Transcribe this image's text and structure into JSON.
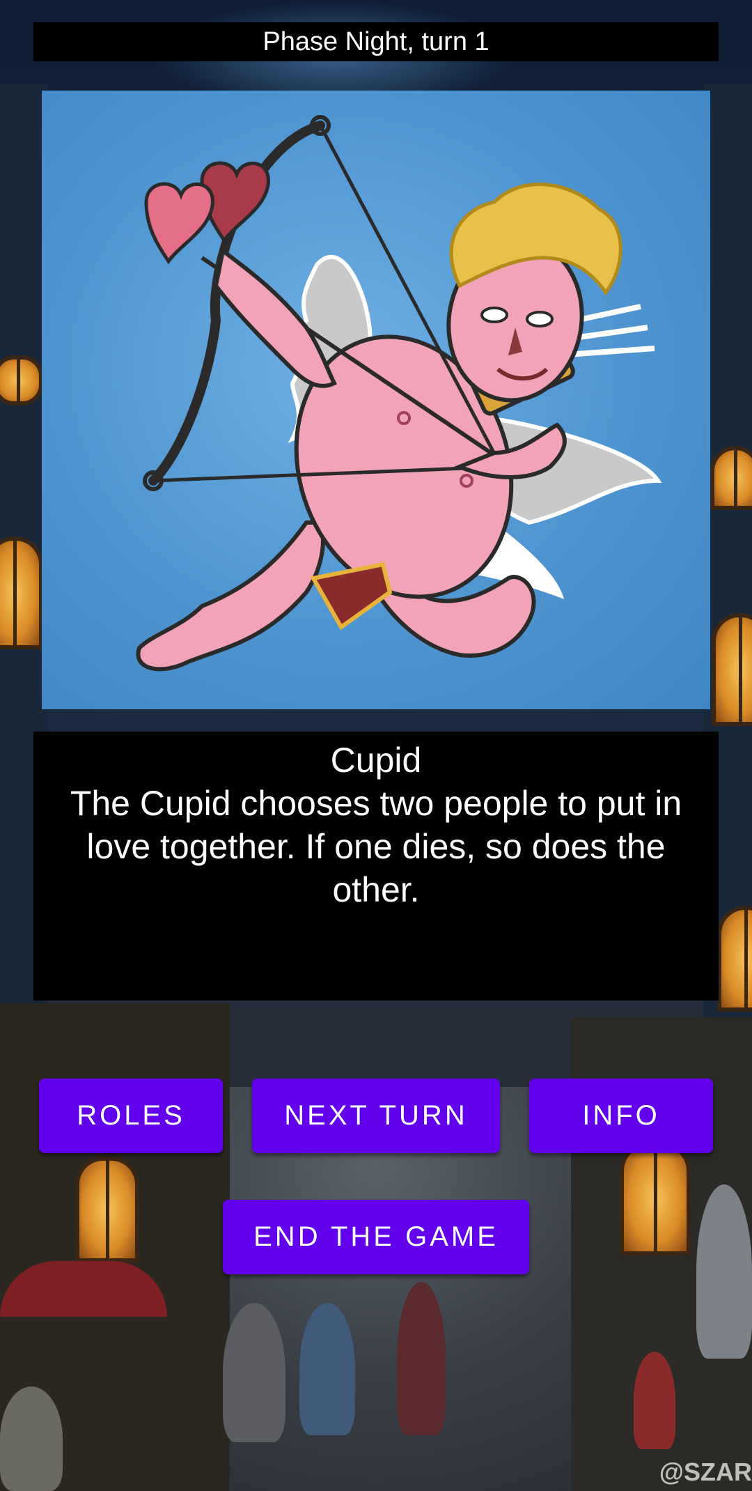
{
  "phase": {
    "label": "Phase Night, turn 1"
  },
  "card": {
    "image_subject": "cupid-illustration"
  },
  "role": {
    "name": "Cupid",
    "description": "The Cupid chooses two people to put in love together. If one dies, so does the other."
  },
  "buttons": {
    "roles": "ROLES",
    "next_turn": "NEXT TURN",
    "info": "INFO",
    "end_game": "END THE GAME"
  },
  "watermark": "@SZAR",
  "colors": {
    "accent": "#6200ee",
    "panel": "#000000",
    "text": "#ffffff",
    "card_background": "#4e94d0"
  }
}
